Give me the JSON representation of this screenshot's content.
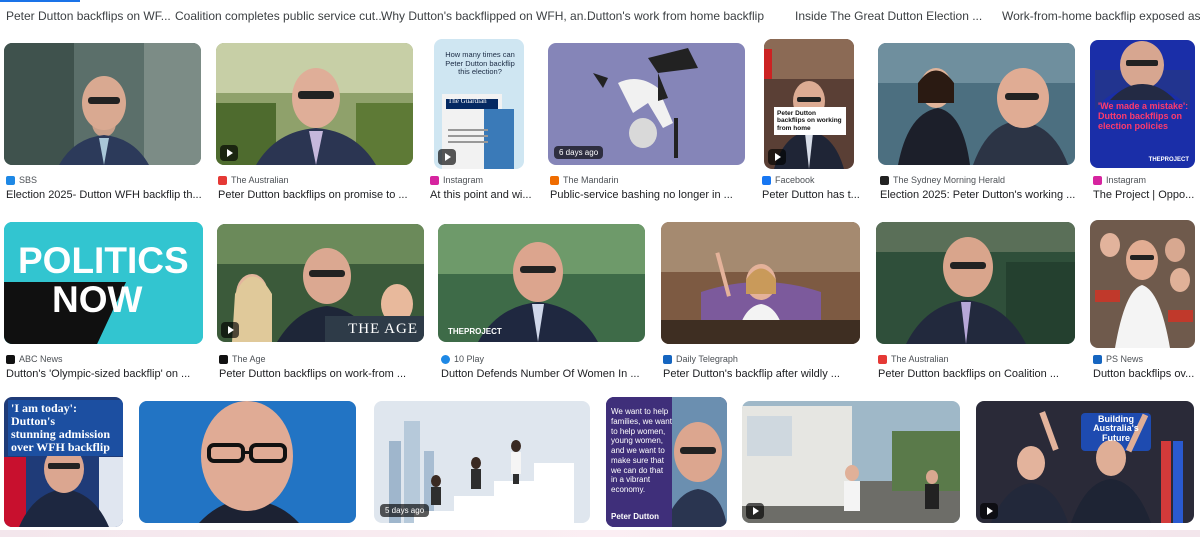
{
  "top_links": [
    "Peter Dutton backflips on WF...",
    "Coalition completes public service cut...",
    "Why Dutton's backflipped on WFH, an...",
    "Dutton's work from home backflip",
    "Inside The Great Dutton Election ...",
    "Work-from-home backflip exposed as ..."
  ],
  "row1": [
    {
      "source": "SBS",
      "title": "Election 2025- Dutton WFH backflip th...",
      "fav_color": "#1e88e5"
    },
    {
      "source": "The Australian",
      "title": "Peter Dutton backflips on promise to ...",
      "fav_color": "#e53935"
    },
    {
      "source": "Instagram",
      "title": "At this point and wi...",
      "fav_color": "#d6249f"
    },
    {
      "source": "The Mandarin",
      "title": "Public-service bashing no longer in ...",
      "fav_color": "#ef6c00",
      "badge": "6 days ago"
    },
    {
      "source": "Facebook",
      "title": "Peter Dutton has t...",
      "fav_color": "#1877f2"
    },
    {
      "source": "The Sydney Morning Herald",
      "title": "Election 2025: Peter Dutton's working ...",
      "fav_color": "#222222"
    },
    {
      "source": "Instagram",
      "title": "The Project | Oppo...",
      "fav_color": "#d6249f"
    }
  ],
  "row2": [
    {
      "source": "ABC News",
      "title": "Dutton's 'Olympic-sized backflip' on ...",
      "fav_color": "#111111"
    },
    {
      "source": "The Age",
      "title": "Peter Dutton backflips on work-from ...",
      "fav_color": "#111111"
    },
    {
      "source": "10 Play",
      "title": "Dutton Defends Number Of Women In ...",
      "fav_color": "#1e88e5"
    },
    {
      "source": "Daily Telegraph",
      "title": "Peter Dutton's backflip after wildly ...",
      "fav_color": "#1565c0"
    },
    {
      "source": "The Australian",
      "title": "Peter Dutton backflips on Coalition ...",
      "fav_color": "#e53935"
    },
    {
      "source": "PS News",
      "title": "Dutton backflips ov...",
      "fav_color": "#1565c0"
    }
  ],
  "row3_badge": "5 days ago",
  "thumb_text": {
    "guardian_q": "How many times can Peter Dutton backflip this election?",
    "guardian_brand": "The Guardian",
    "sky_caption": "Peter Dutton backflips on working from home",
    "project_quote": "'We made a mistake': Dutton backflips on election policies",
    "project_brand": "THEPROJECT",
    "politics_now": [
      "POLITICS",
      "NOW"
    ],
    "age_brand": "THE AGE",
    "tenplay_brand": "THEPROJECT",
    "headline_admission": [
      "'I am today': Dutton's",
      "stunning admission",
      "over WFH backflip"
    ],
    "quote_lines": [
      "We want to help",
      "families, we want",
      "to help women,",
      "young women,",
      "and we want to",
      "make sure that",
      "we can do that",
      "in a vibrant",
      "economy."
    ],
    "quote_author": "Peter Dutton",
    "building_sign": [
      "Building",
      "Australia's",
      "Future"
    ]
  }
}
